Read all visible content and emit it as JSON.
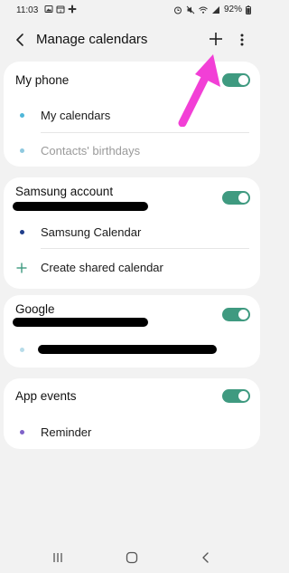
{
  "status_bar": {
    "time": "11:03",
    "battery": "92%",
    "left_icons": [
      "photo-icon",
      "calendar-icon",
      "slack-icon"
    ],
    "right_icons": [
      "alarm-icon",
      "mute-icon",
      "wifi-icon",
      "signal-icon",
      "battery-icon"
    ]
  },
  "header": {
    "title": "Manage calendars"
  },
  "sections": [
    {
      "title": "My phone",
      "toggle_on": true,
      "items": [
        {
          "label": "My calendars",
          "dot_color": "#4fb7d9",
          "muted": false
        },
        {
          "label": "Contacts' birthdays",
          "dot_color": "#8fc9df",
          "muted": true
        }
      ]
    },
    {
      "title": "Samsung account",
      "toggle_on": true,
      "items": [
        {
          "label": "Samsung Calendar",
          "dot_color": "#1f3d8a",
          "muted": false
        },
        {
          "label": "Create shared calendar",
          "icon": "plus-icon",
          "muted": false
        }
      ]
    },
    {
      "title": "Google",
      "toggle_on": true,
      "items": [
        {
          "label": "",
          "dot_color": "#b7dce9",
          "muted": false
        }
      ]
    },
    {
      "title": "App events",
      "toggle_on": true,
      "items": [
        {
          "label": "Reminder",
          "dot_color": "#7f62c9",
          "muted": false
        }
      ]
    }
  ],
  "colors": {
    "accent_toggle": "#3f9a80",
    "annotation_arrow": "#f23fd6",
    "background": "#f2f2f2",
    "card": "#ffffff"
  },
  "nav": {
    "icons": [
      "recent-apps-icon",
      "home-icon",
      "back-nav-icon"
    ]
  }
}
